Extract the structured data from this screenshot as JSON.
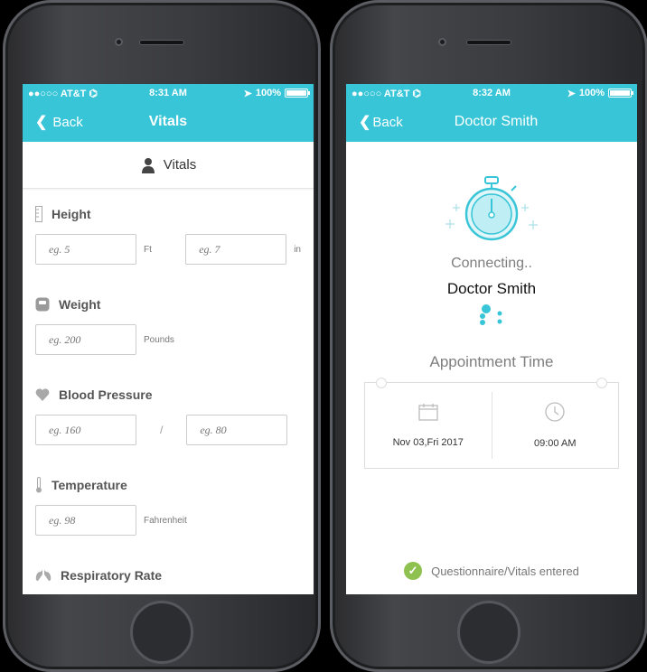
{
  "left": {
    "status": {
      "carrier": "●●○○○ AT&T ⌬",
      "time": "8:31 AM",
      "battery": "100%"
    },
    "nav": {
      "back": "Back",
      "title": "Vitals"
    },
    "section_title": "Vitals",
    "fields": {
      "height": {
        "label": "Height",
        "ft_placeholder": "eg. 5",
        "ft_unit": "Ft",
        "in_placeholder": "eg. 7",
        "in_unit": "in"
      },
      "weight": {
        "label": "Weight",
        "placeholder": "eg. 200",
        "unit": "Pounds"
      },
      "bp": {
        "label": "Blood Pressure",
        "sys_placeholder": "eg. 160",
        "separator": "/",
        "dia_placeholder": "eg. 80"
      },
      "temp": {
        "label": "Temperature",
        "placeholder": "eg. 98",
        "unit": "Fahrenheit"
      },
      "resp": {
        "label": "Respiratory Rate"
      }
    }
  },
  "right": {
    "status": {
      "carrier": "●●○○○ AT&T ⌬",
      "time": "8:32 AM",
      "battery": "100%"
    },
    "nav": {
      "back": "Back",
      "title": "Doctor Smith"
    },
    "connecting": "Connecting..",
    "doctor": "Doctor Smith",
    "appointment_label": "Appointment Time",
    "date": "Nov 03,Fri 2017",
    "time": "09:00 AM",
    "footer": "Questionnaire/Vitals entered"
  },
  "colors": {
    "accent": "#37c5d7",
    "check": "#8fc150"
  }
}
